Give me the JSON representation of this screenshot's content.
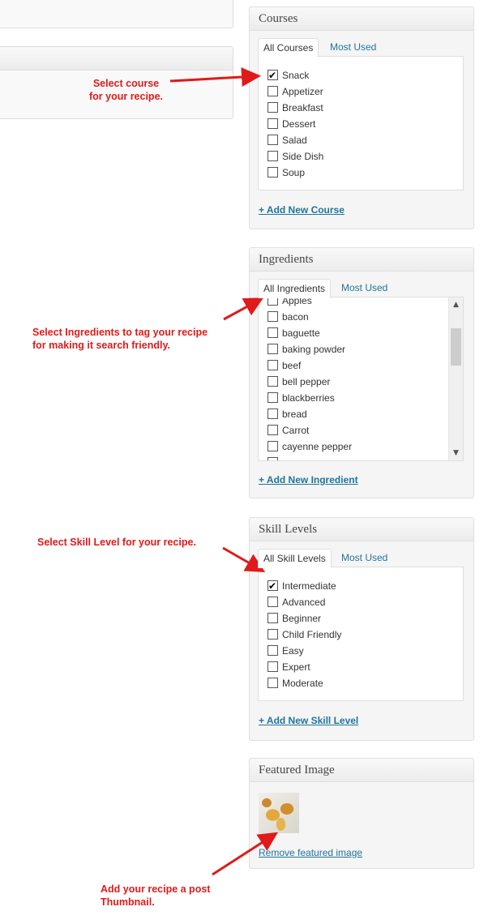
{
  "courses": {
    "title": "Courses",
    "tabs": [
      "All Courses",
      "Most Used"
    ],
    "items": [
      {
        "label": "Snack",
        "checked": true
      },
      {
        "label": "Appetizer",
        "checked": false
      },
      {
        "label": "Breakfast",
        "checked": false
      },
      {
        "label": "Dessert",
        "checked": false
      },
      {
        "label": "Salad",
        "checked": false
      },
      {
        "label": "Side Dish",
        "checked": false
      },
      {
        "label": "Soup",
        "checked": false
      }
    ],
    "add_link": "+ Add New Course"
  },
  "ingredients": {
    "title": "Ingredients",
    "tabs": [
      "All Ingredients",
      "Most Used"
    ],
    "items": [
      {
        "label": "Apples",
        "checked": false
      },
      {
        "label": "bacon",
        "checked": false
      },
      {
        "label": "baguette",
        "checked": false
      },
      {
        "label": "baking powder",
        "checked": false
      },
      {
        "label": "beef",
        "checked": false
      },
      {
        "label": "bell pepper",
        "checked": false
      },
      {
        "label": "blackberries",
        "checked": false
      },
      {
        "label": "bread",
        "checked": false
      },
      {
        "label": "Carrot",
        "checked": false
      },
      {
        "label": "cayenne pepper",
        "checked": false
      }
    ],
    "add_link": "+ Add New Ingredient"
  },
  "skill_levels": {
    "title": "Skill Levels",
    "tabs": [
      "All Skill Levels",
      "Most Used"
    ],
    "items": [
      {
        "label": "Intermediate",
        "checked": true
      },
      {
        "label": "Advanced",
        "checked": false
      },
      {
        "label": "Beginner",
        "checked": false
      },
      {
        "label": "Child Friendly",
        "checked": false
      },
      {
        "label": "Easy",
        "checked": false
      },
      {
        "label": "Expert",
        "checked": false
      },
      {
        "label": "Moderate",
        "checked": false
      }
    ],
    "add_link": "+ Add New Skill Level"
  },
  "featured_image": {
    "title": "Featured Image",
    "remove_link": "Remove featured image"
  },
  "annotations": {
    "course": [
      "Select course",
      "for your recipe."
    ],
    "ingredients": [
      "Select Ingredients to tag your recipe",
      "for making it search friendly."
    ],
    "skill": [
      "Select Skill Level for your recipe."
    ],
    "thumbnail": [
      "Add your recipe a post",
      "Thumbnail."
    ]
  },
  "colors": {
    "annotation_red": "#e01a1a",
    "link_blue": "#21759b"
  }
}
